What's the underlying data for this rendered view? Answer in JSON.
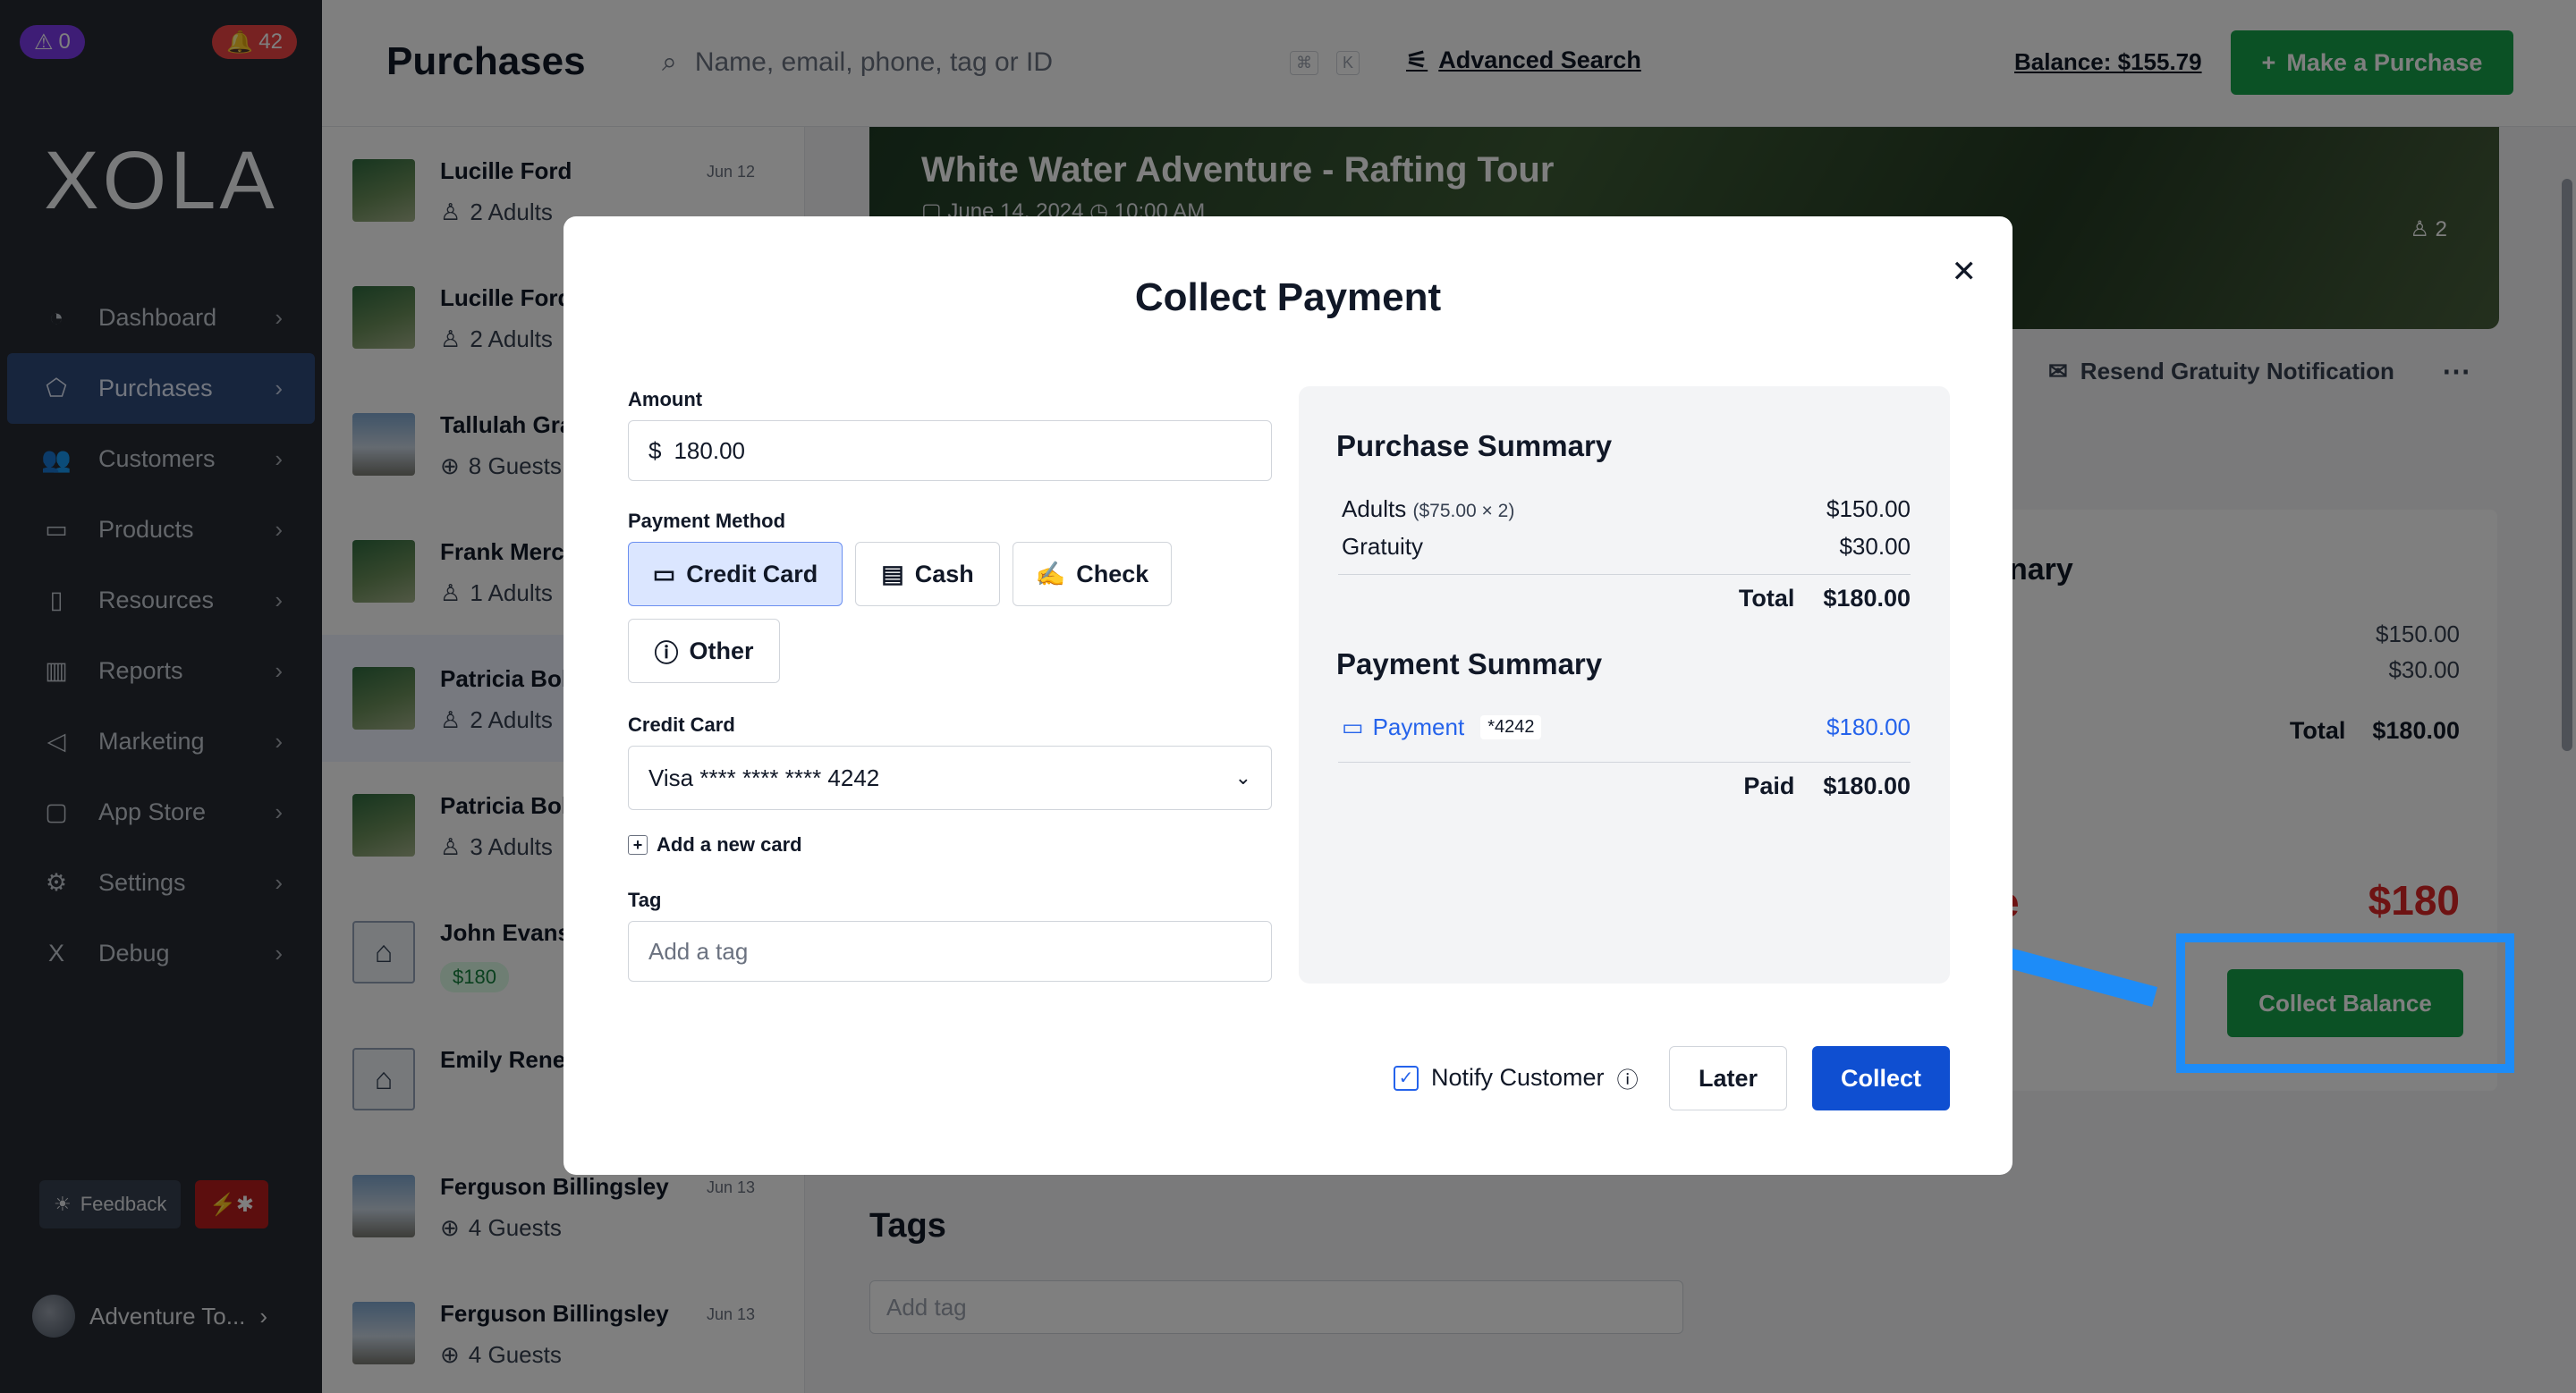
{
  "sidebar": {
    "warning_count": "0",
    "alert_count": "42",
    "logo": "XOLA",
    "items": [
      {
        "label": "Dashboard"
      },
      {
        "label": "Purchases"
      },
      {
        "label": "Customers"
      },
      {
        "label": "Products"
      },
      {
        "label": "Resources"
      },
      {
        "label": "Reports"
      },
      {
        "label": "Marketing"
      },
      {
        "label": "App Store"
      },
      {
        "label": "Settings"
      },
      {
        "label": "Debug"
      }
    ],
    "feedback_label": "Feedback",
    "account_name": "Adventure To..."
  },
  "header": {
    "title": "Purchases",
    "search_placeholder": "Name, email, phone, tag or ID",
    "advanced_search": "Advanced Search",
    "balance": "Balance: $155.79",
    "make_purchase": "Make a Purchase"
  },
  "purchases": [
    {
      "name": "Lucille Ford",
      "date": "Jun 12",
      "sub": "2 Adults"
    },
    {
      "name": "Lucille Ford",
      "date": "",
      "sub": "2 Adults"
    },
    {
      "name": "Tallulah Gra",
      "date": "",
      "sub": "8 Guests"
    },
    {
      "name": "Frank Merc",
      "date": "",
      "sub": "1 Adults"
    },
    {
      "name": "Patricia Bol",
      "date": "",
      "sub": "2 Adults"
    },
    {
      "name": "Patricia Bol",
      "date": "",
      "sub": "3 Adults"
    },
    {
      "name": "John Evans",
      "date": "",
      "tag": "$180"
    },
    {
      "name": "Emily Rene",
      "date": ""
    },
    {
      "name": "Ferguson Billingsley",
      "date": "Jun 13",
      "sub": "4 Guests"
    },
    {
      "name": "Ferguson Billingsley",
      "date": "Jun 13",
      "sub": "4 Guests"
    }
  ],
  "detail": {
    "title": "White Water Adventure - Rafting Tour",
    "date": "June 14, 2024",
    "time": "10:00 AM",
    "guest_count": "2",
    "resend": "Resend Gratuity Notification",
    "summary_title_fragment": "nary",
    "line1": "$150.00",
    "line2": "$30.00",
    "total_label": "Total",
    "total": "$180.00",
    "due_fragment": "e",
    "due": "$180",
    "collect_balance": "Collect Balance",
    "tags_heading": "Tags",
    "tags_placeholder": "Add tag"
  },
  "modal": {
    "title": "Collect Payment",
    "amount_label": "Amount",
    "currency": "$",
    "amount": "180.00",
    "method_label": "Payment Method",
    "methods": [
      "Credit Card",
      "Cash",
      "Check",
      "Other"
    ],
    "selected_method": "Credit Card",
    "card_label": "Credit Card",
    "card_value": "Visa **** **** **** 4242",
    "add_card": "Add a new card",
    "tag_label": "Tag",
    "tag_placeholder": "Add a tag",
    "purchase_summary": {
      "heading": "Purchase Summary",
      "items": [
        {
          "label": "Adults",
          "detail": "($75.00 × 2)",
          "amount": "$150.00"
        },
        {
          "label": "Gratuity",
          "detail": "",
          "amount": "$30.00"
        }
      ],
      "total_label": "Total",
      "total": "$180.00"
    },
    "payment_summary": {
      "heading": "Payment Summary",
      "payment_label": "Payment",
      "card_last4": "*4242",
      "payment_amount": "$180.00",
      "paid_label": "Paid",
      "paid": "$180.00"
    },
    "notify_label": "Notify Customer",
    "notify_checked": true,
    "later": "Later",
    "collect": "Collect"
  },
  "colors": {
    "highlight": "#1d8cf8",
    "primary": "#0f4fd1",
    "success": "#16a34a"
  }
}
